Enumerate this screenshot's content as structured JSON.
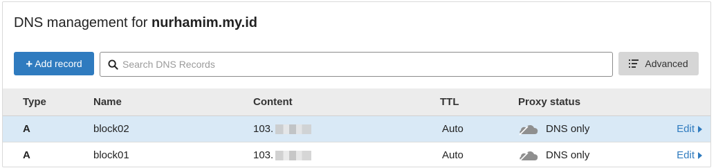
{
  "header": {
    "title_prefix": "DNS management for",
    "domain": "nurhamim.my.id"
  },
  "toolbar": {
    "add_label": "Add record",
    "search_placeholder": "Search DNS Records",
    "search_value": "",
    "advanced_label": "Advanced"
  },
  "table": {
    "columns": {
      "type": "Type",
      "name": "Name",
      "content": "Content",
      "ttl": "TTL",
      "proxy": "Proxy status"
    },
    "rows": [
      {
        "type": "A",
        "name": "block02",
        "content": "103.",
        "ttl": "Auto",
        "proxy": "DNS only",
        "action": "Edit"
      },
      {
        "type": "A",
        "name": "block01",
        "content": "103.",
        "ttl": "Auto",
        "proxy": "DNS only",
        "action": "Edit"
      }
    ]
  },
  "colors": {
    "primary": "#2f7bbf",
    "selected_row": "#d9e9f6",
    "header_bg": "#ececec",
    "cloud_gray": "#8f8f8f"
  },
  "icons": {
    "search": "search-icon",
    "advanced": "filter-list-icon",
    "proxy": "cloud-dns-only-icon",
    "edit_caret": "caret-right-icon"
  }
}
